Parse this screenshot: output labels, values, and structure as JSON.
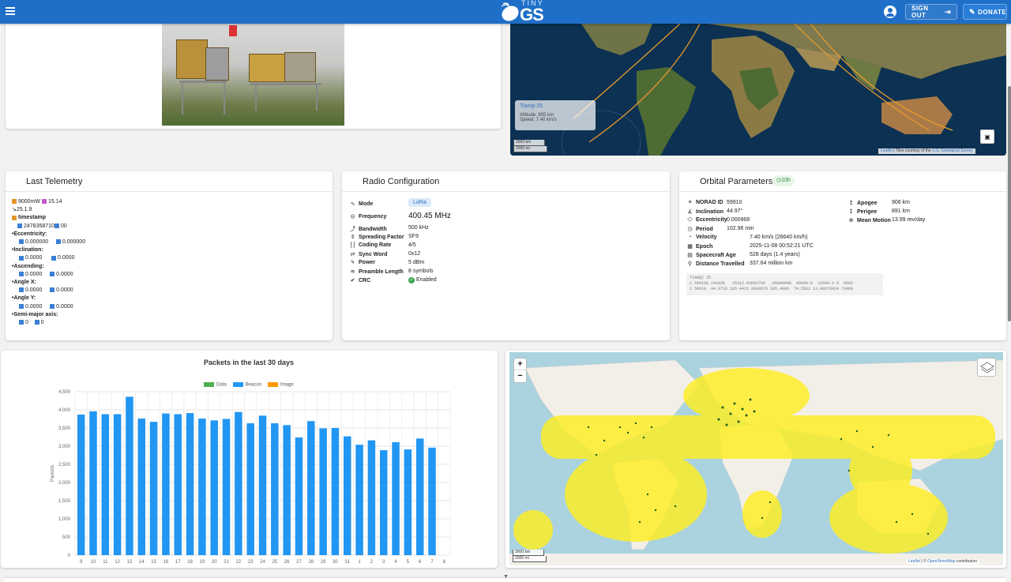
{
  "header": {
    "logo_small": "TINY",
    "logo_big": "GS",
    "sign_out_label": "SIGN OUT",
    "donate_label": "DONATE"
  },
  "satellite_tooltip": {
    "name": "Tianqi-25",
    "altitude": "Altitude: 905 km",
    "speed": "Speed: 7.40 km/s"
  },
  "map_top": {
    "scale_km": "3000 km",
    "scale_mi": "2000 mi",
    "attribution_leaflet": "Leaflet",
    "attribution_text": " | Tiles courtesy of the ",
    "attribution_link": "U.S. Geological Survey"
  },
  "telemetry": {
    "title": "Last Telemetry",
    "line1_power": "9000mW",
    "line1_value": "15.14",
    "version": "25.1.9",
    "timestamp_label": "timestamp",
    "timestamp_val1": "2478358710",
    "timestamp_val2": "00",
    "eccentricity_label": "Eccentricity:",
    "ecc_v1": "0.000000",
    "ecc_v2": "0.000000",
    "inclination_label": "Inclination:",
    "inc_v1": "0.0000",
    "inc_v2": "0.0000",
    "ascending_label": "Ascending:",
    "asc_v1": "0.0000",
    "asc_v2": "0.0000",
    "anglex_label": "Angle X:",
    "ax_v1": "0.0000",
    "ax_v2": "0.0000",
    "angley_label": "Angle Y:",
    "ay_v1": "0.0000",
    "ay_v2": "0.0000",
    "semimajor_label": "Semi-major axis:",
    "sm_v1": "0",
    "sm_v2": "0"
  },
  "radio": {
    "title": "Radio Configuration",
    "rows": [
      {
        "key": "Mode",
        "value": "LoRa"
      },
      {
        "key": "Frequency",
        "value": "400.45 MHz"
      },
      {
        "key": "Bandwidth",
        "value": "500 kHz"
      },
      {
        "key": "Spreading Factor",
        "value": "SF9"
      },
      {
        "key": "Coding Rate",
        "value": "4/5"
      },
      {
        "key": "Sync Word",
        "value": "0x12"
      },
      {
        "key": "Power",
        "value": "5 dBm"
      },
      {
        "key": "Preamble Length",
        "value": "8 symbols"
      },
      {
        "key": "CRC",
        "value": "Enabled"
      }
    ]
  },
  "orbital": {
    "title": "Orbital Parameters",
    "age_chip": "10h",
    "rows": [
      {
        "key": "NORAD ID",
        "value": "59910"
      },
      {
        "key": "Inclination",
        "value": "44.97°"
      },
      {
        "key": "Eccentricity",
        "value": "0.000968"
      },
      {
        "key": "Period",
        "value": "102.96 min"
      },
      {
        "key": "Velocity",
        "value": "7.40 km/s (26640 km/h)"
      },
      {
        "key": "Epoch",
        "value": "2025-11-08 00:52:21 UTC"
      },
      {
        "key": "Spacecraft Age",
        "value": "528 days (1.4 years)"
      },
      {
        "key": "Distance Travelled",
        "value": "337.64 million km"
      }
    ],
    "right_rows": [
      {
        "key": "Apogee",
        "value": "906 km"
      },
      {
        "key": "Perigee",
        "value": "891 km"
      },
      {
        "key": "Mean Motion",
        "value": "13.99 rev/day"
      }
    ],
    "tle_name": "TIANQI 25",
    "tle_line1": "1 59910U 24182E   25312.03682706  .00000098  00000-0  15500-3 0  9992",
    "tle_line2": "2 59910  44.9716 165.4415 0009676 205.4906  74.5563 13.98676024 73468"
  },
  "chart_data": {
    "type": "bar",
    "title": "Packets in the last 30 days",
    "ylabel": "Packets",
    "legend": [
      "Data",
      "Beacon",
      "Image"
    ],
    "categories": [
      "9",
      "10",
      "11",
      "12",
      "13",
      "14",
      "15",
      "16",
      "17",
      "18",
      "19",
      "20",
      "21",
      "22",
      "23",
      "24",
      "25",
      "26",
      "27",
      "28",
      "29",
      "30",
      "31",
      "1",
      "2",
      "3",
      "4",
      "5",
      "6",
      "7",
      "8"
    ],
    "series": [
      {
        "name": "Beacon",
        "values": [
          3870,
          3960,
          3880,
          3880,
          4360,
          3760,
          3670,
          3900,
          3880,
          3910,
          3760,
          3710,
          3750,
          3940,
          3630,
          3840,
          3630,
          3580,
          3240,
          3690,
          3490,
          3500,
          3270,
          3040,
          3160,
          2890,
          3110,
          2910,
          3210,
          2960,
          0
        ]
      }
    ],
    "ylim": [
      0,
      4500
    ],
    "yticks": [
      "0",
      "500",
      "1,000",
      "1,500",
      "2,000",
      "2,500",
      "3,000",
      "3,500",
      "4,000",
      "4,500"
    ],
    "colors": {
      "Data": "#4caf50",
      "Beacon": "#2196f3",
      "Image": "#ff9800"
    }
  },
  "map_bottom": {
    "zoom_in": "+",
    "zoom_out": "−",
    "scale_km": "3000 km",
    "scale_mi": "2000 mi",
    "attribution_leaflet": "Leaflet",
    "attribution_osm": "OpenStreetMap",
    "attribution_tail": " contributors"
  }
}
